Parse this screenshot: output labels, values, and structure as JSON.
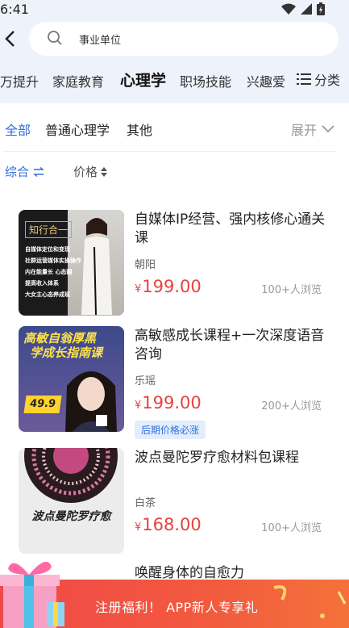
{
  "status": {
    "time": "6:41"
  },
  "search": {
    "placeholder": "事业单位"
  },
  "categories": {
    "items": [
      "万提升",
      "家庭教育",
      "心理学",
      "职场技能",
      "兴趣爱"
    ],
    "more_label": "分类"
  },
  "subcategories": {
    "items": [
      "全部",
      "普通心理学",
      "其他"
    ],
    "expand_label": "展开"
  },
  "sort": {
    "comprehensive": "综合",
    "price": "价格"
  },
  "courses": [
    {
      "title": "自媒体IP经营、强内核修心通关课",
      "author": "朝阳",
      "currency": "¥",
      "price": "199.00",
      "views": "100+人浏览",
      "tag": "",
      "thumb_text": [
        "知行合一",
        "自媒体定位和变现",
        "社群运营媒体实操操作",
        "内在能量长",
        "心态翻",
        "提高收入体系",
        "大女主心态养成班"
      ]
    },
    {
      "title": "高敏感成长课程+一次深度语音咨询",
      "author": "乐瑶",
      "currency": "¥",
      "price": "199.00",
      "views": "200+人浏览",
      "tag": "后期价格必涨",
      "thumb_text": [
        "高敏自翁厚黑",
        "学成长指南课",
        "49.9"
      ]
    },
    {
      "title": "波点曼陀罗疗愈材料包课程",
      "author": "白茶",
      "currency": "¥",
      "price": "168.00",
      "views": "100+人浏览",
      "tag": "",
      "thumb_text": [
        "波点曼陀罗疗愈"
      ]
    },
    {
      "title": "唤醒身体的自愈力",
      "author": "",
      "currency": "",
      "price": "",
      "views": "",
      "tag": "",
      "thumb_text": []
    }
  ],
  "banner": {
    "text": "注册福利！ APP新人专享礼"
  },
  "colors": {
    "accent": "#2e6fe0",
    "price": "#e64340",
    "banner": "#f04848"
  }
}
